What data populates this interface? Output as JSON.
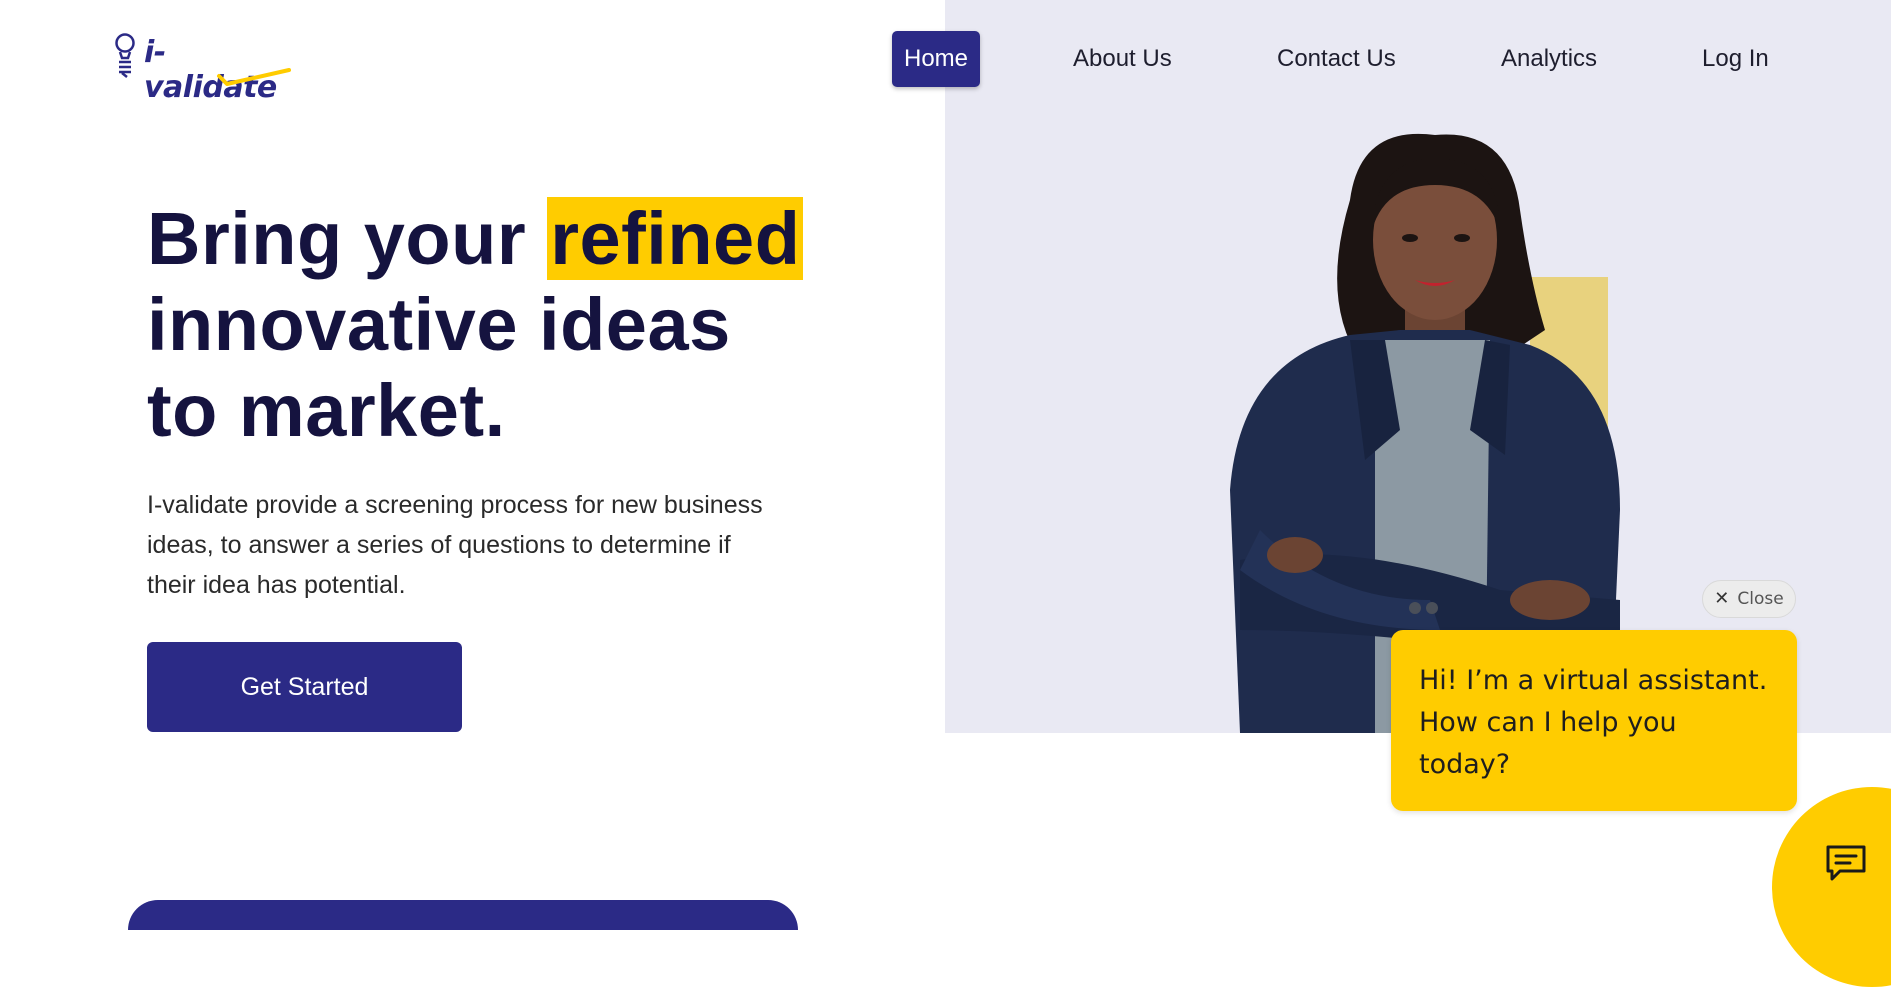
{
  "brand": {
    "logo_text": "i-validate",
    "colors": {
      "primary": "#2b2a86",
      "accent": "#ffcc00",
      "hero_bg": "#e9e9f3"
    }
  },
  "nav": {
    "items": [
      {
        "label": "Home",
        "active": true
      },
      {
        "label": "About Us",
        "active": false
      },
      {
        "label": "Contact Us",
        "active": false
      },
      {
        "label": "Analytics",
        "active": false
      },
      {
        "label": "Log In",
        "active": false
      }
    ]
  },
  "hero": {
    "headline_prefix": "Bring your ",
    "headline_highlight": "refined",
    "headline_line2": "innovative ideas",
    "headline_line3": "to market.",
    "description": "I-validate provide a screening process for new business ideas, to answer a series of questions to determine if their idea has potential.",
    "cta_label": "Get Started",
    "image_icon": "woman-portrait-image"
  },
  "chat": {
    "close_label": "Close",
    "close_icon": "close-icon",
    "message": "Hi! I’m a virtual assistant. How can I help you today?",
    "launcher_icon": "chat-bubble-icon"
  }
}
